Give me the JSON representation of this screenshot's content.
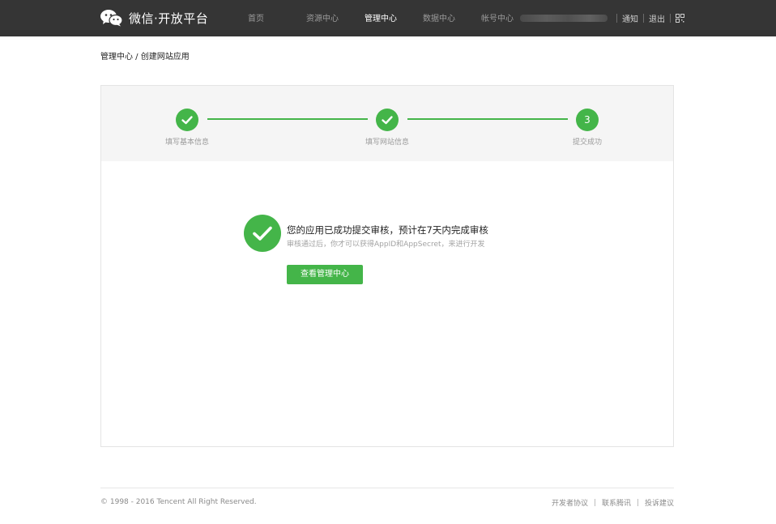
{
  "header": {
    "logo_text": "微信·开放平台",
    "nav": [
      {
        "label": "首页",
        "active": false
      },
      {
        "label": "资源中心",
        "active": false
      },
      {
        "label": "管理中心",
        "active": true
      },
      {
        "label": "数据中心",
        "active": false
      },
      {
        "label": "帐号中心",
        "active": false
      }
    ],
    "actions": {
      "notify": "通知",
      "logout": "退出"
    },
    "icons": {
      "logo": "wechat-icon",
      "qr": "qrcode-icon"
    }
  },
  "breadcrumb": "管理中心 / 创建网站应用",
  "steps": [
    {
      "label": "填写基本信息",
      "status": "done"
    },
    {
      "label": "填写网站信息",
      "status": "done"
    },
    {
      "label": "提交成功",
      "number": "3",
      "status": "current"
    }
  ],
  "result": {
    "title": "您的应用已成功提交审核，预计在7天内完成审核",
    "subtitle": "审核通过后，你才可以获得AppID和AppSecret，来进行开发",
    "button": "查看管理中心"
  },
  "footer": {
    "copyright": "© 1998 - 2016 Tencent All Right Reserved.",
    "links": [
      "开发者协议",
      "联系腾讯",
      "投诉建议"
    ]
  },
  "colors": {
    "accent": "#44b549",
    "topbar": "#353535"
  }
}
